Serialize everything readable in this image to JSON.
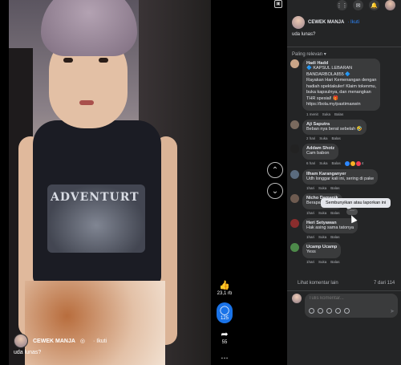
{
  "video": {
    "owner_name": "CEWEK MANJA",
    "verified_mark": "◎",
    "follow_label": "· Ikuti",
    "caption": "uda lunas?",
    "shirt_text": "ADVENTURT"
  },
  "actions": {
    "likes": "23,1 rb",
    "comments": "125",
    "shares": "55",
    "more": "..."
  },
  "post": {
    "author": "CEWEK MANJA",
    "follow_label": "· Ikuti",
    "caption": "uda lunas?",
    "sort_label": "Paling relevan ▾"
  },
  "comments": [
    {
      "name": "Hadi Hadd",
      "text": "🔷 KAPSUL LEBARAN\nBANDARBOLA855 🔷\nRayakan Hari Kemenangan dengan\nhadiah spektakuler! Klaim tokenmu,\nbuka kapsulnya, dan menangkan\nTHR spesial! 🎁\nhttps://bola.my/pastimaxwin",
      "time": "1 menit",
      "like": "Suka",
      "reply": "Balas",
      "reactions": "",
      "avatar_color": "#c9a487"
    },
    {
      "name": "Aji Saputra",
      "text": "Beban nya berat sebelah 🤣",
      "time": "2 hari",
      "like": "Suka",
      "reply": "Balas",
      "reactions": "",
      "avatar_color": "#7a6a5e"
    },
    {
      "name": "Addam Shotz",
      "text": "Cam babon",
      "time": "6 hari",
      "like": "Suka",
      "reply": "Balas",
      "reactions": "4",
      "avatar_color": "#222222"
    },
    {
      "name": "Ilham Karanganyer",
      "text": "Udh longgar kali ini, sering di pake",
      "time": "1hari",
      "like": "Suka",
      "reply": "Balas",
      "reactions": "",
      "avatar_color": "#5a6b7e"
    },
    {
      "name": "Nicho Damanik",
      "text": "Berapa emang?",
      "time": "1hari",
      "like": "Suka",
      "reply": "Balas",
      "reactions": "",
      "avatar_color": "#6e5b50"
    },
    {
      "name": "Heri Setyawan",
      "text": "Hak asing sama tatonya",
      "time": "1hari",
      "like": "Suka",
      "reply": "Balas",
      "reactions": "",
      "avatar_color": "#8a2d2d"
    },
    {
      "name": "Ucamp Ucamp",
      "text": "Yess",
      "time": "1hari",
      "like": "Suka",
      "reply": "Balas",
      "reactions": "",
      "avatar_color": "#4d8a4a"
    }
  ],
  "tooltip": "Sembunyikan atau laporkan ini",
  "see_more": "Lihat komentar lain",
  "count": "7 dari 114",
  "composer": {
    "placeholder": "Tulis komentar..."
  },
  "colors": {
    "panel_bg": "#242526",
    "bubble_bg": "#3a3b3c",
    "accent": "#2d88ff"
  }
}
